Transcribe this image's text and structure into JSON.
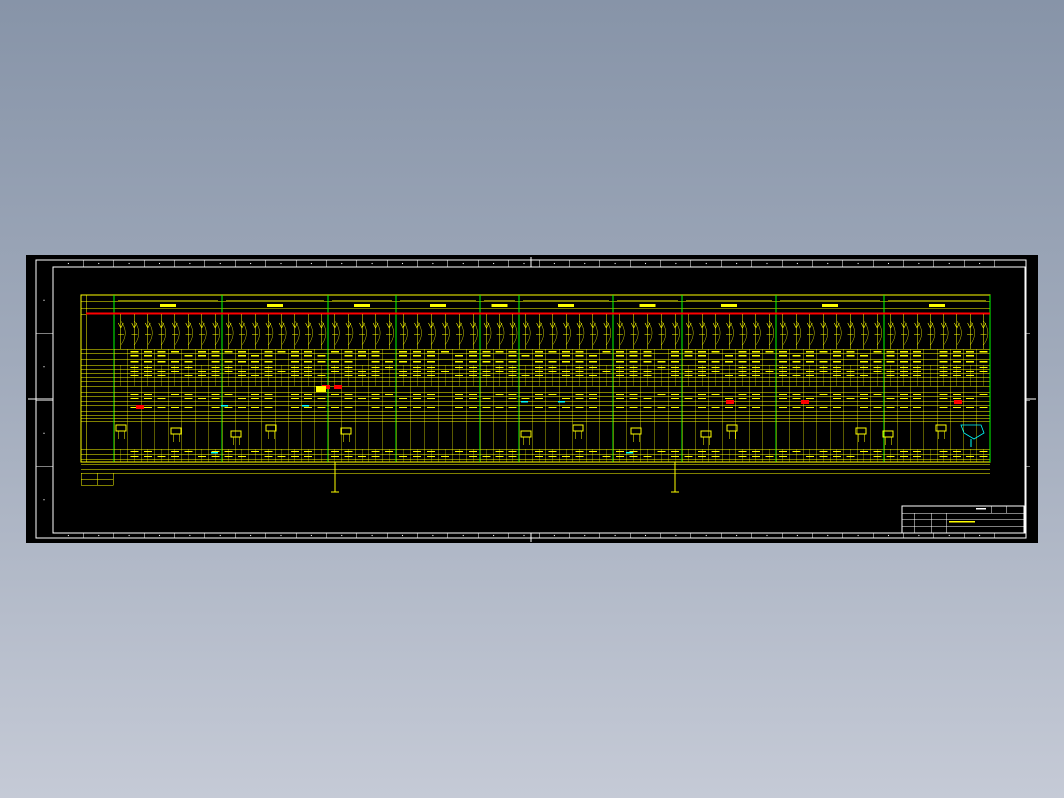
{
  "drawing": {
    "type": "electrical single-line panel schedule",
    "colors": {
      "background": "#000000",
      "frame": "#ffffff",
      "table": "#ffff00",
      "panel_dividers": "#00ff00",
      "busbar": "#ff0000",
      "highlight_cyan": "#00ffff"
    },
    "grid_columns": 32,
    "grid_rows": 4,
    "sections": 12,
    "title_block": {
      "present": true
    }
  }
}
